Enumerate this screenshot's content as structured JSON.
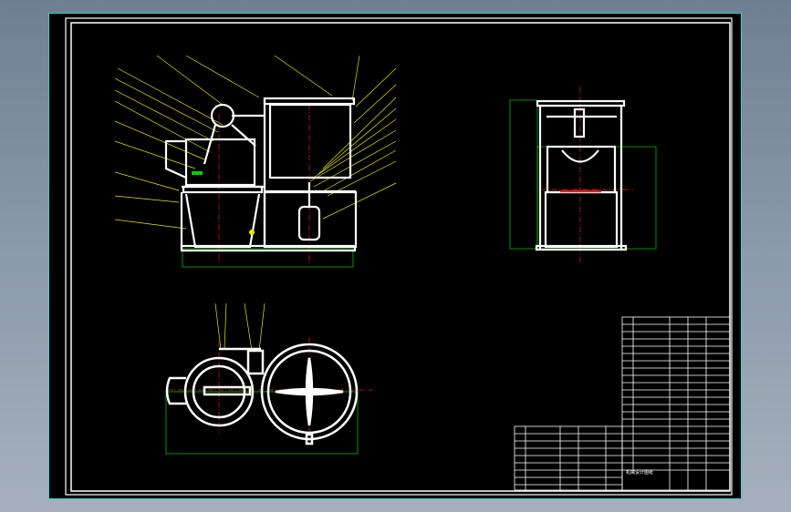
{
  "drawing": {
    "title_block_text": "机械设计图纸",
    "colors": {
      "background": "#000000",
      "frame": "#ffffff",
      "border_accent": "#2ad4d4",
      "leader": "#e8e800",
      "dimension": "#00d000",
      "centerline": "#e02020"
    },
    "views": [
      "front-view",
      "side-view",
      "top-view"
    ]
  }
}
